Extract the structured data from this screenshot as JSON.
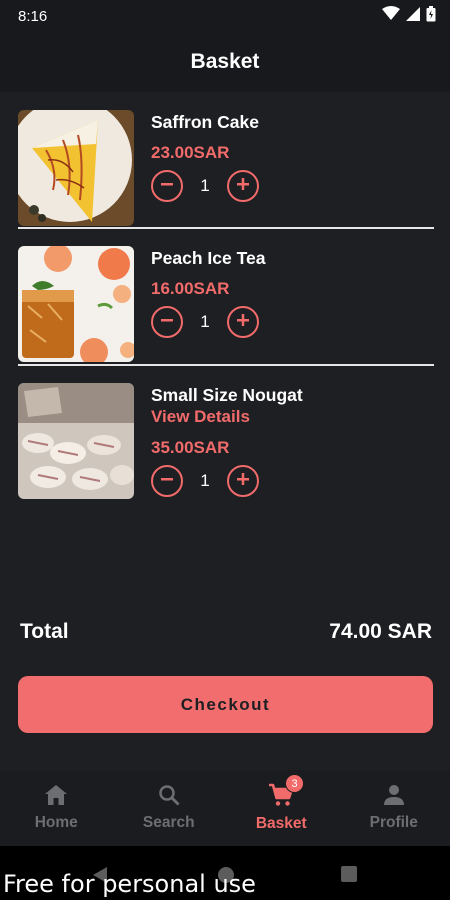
{
  "status_bar": {
    "time": "8:16"
  },
  "header": {
    "title": "Basket"
  },
  "items": [
    {
      "name": "Saffron Cake",
      "price": "23.00SAR",
      "quantity": "1"
    },
    {
      "name": "Peach Ice Tea",
      "price": "16.00SAR",
      "quantity": "1"
    },
    {
      "name": "Small Size Nougat",
      "details_link": "View Details",
      "price": "35.00SAR",
      "quantity": "1"
    }
  ],
  "summary": {
    "total_label": "Total",
    "total_value": "74.00 SAR"
  },
  "checkout": {
    "label": "Checkout"
  },
  "bottom_nav": [
    {
      "label": "Home",
      "icon": "home-icon"
    },
    {
      "label": "Search",
      "icon": "search-icon"
    },
    {
      "label": "Basket",
      "icon": "cart-icon",
      "badge": "3",
      "active": true
    },
    {
      "label": "Profile",
      "icon": "person-icon"
    }
  ],
  "watermark": "Free for personal use",
  "colors": {
    "accent": "#f26b6b",
    "background": "#1e1f23",
    "button": "#f26d6d"
  }
}
